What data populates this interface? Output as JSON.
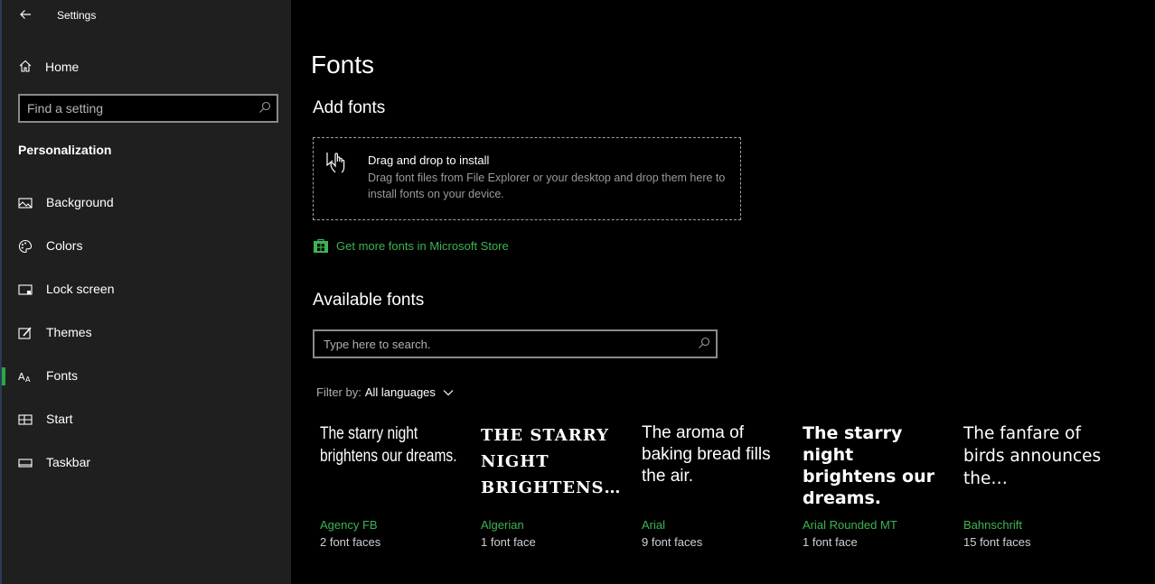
{
  "app": {
    "title": "Settings"
  },
  "sidebar": {
    "home_label": "Home",
    "search_placeholder": "Find a setting",
    "section_title": "Personalization",
    "items": [
      {
        "label": "Background",
        "icon": "image-icon"
      },
      {
        "label": "Colors",
        "icon": "palette-icon"
      },
      {
        "label": "Lock screen",
        "icon": "lock-screen-icon"
      },
      {
        "label": "Themes",
        "icon": "themes-icon"
      },
      {
        "label": "Fonts",
        "icon": "fonts-icon",
        "active": true
      },
      {
        "label": "Start",
        "icon": "start-icon"
      },
      {
        "label": "Taskbar",
        "icon": "taskbar-icon"
      }
    ]
  },
  "main": {
    "title": "Fonts",
    "add_fonts_heading": "Add fonts",
    "dropzone": {
      "title": "Drag and drop to install",
      "description": "Drag font files from File Explorer or your desktop and drop them here to install fonts on your device."
    },
    "store_link": "Get more fonts in Microsoft Store",
    "available_heading": "Available fonts",
    "search_placeholder": "Type here to search.",
    "filter_label": "Filter by:",
    "filter_value": "All languages",
    "fonts": [
      {
        "sample": "The starry night brightens our dreams.",
        "name": "Agency FB",
        "faces": "2 font faces"
      },
      {
        "sample": "THE STARRY NIGHT BRIGHTENS…",
        "name": "Algerian",
        "faces": "1 font face"
      },
      {
        "sample": "The aroma of baking bread fills the air.",
        "name": "Arial",
        "faces": "9 font faces"
      },
      {
        "sample": "The starry night brightens our dreams.",
        "name": "Arial Rounded MT",
        "faces": "1 font face"
      },
      {
        "sample": "The fanfare of birds announces the…",
        "name": "Bahnschrift",
        "faces": "15 font faces"
      }
    ]
  },
  "colors": {
    "accent": "#28a745",
    "link": "#3cb452",
    "sidebar_bg": "#1f1f1f",
    "main_bg": "#000000"
  }
}
